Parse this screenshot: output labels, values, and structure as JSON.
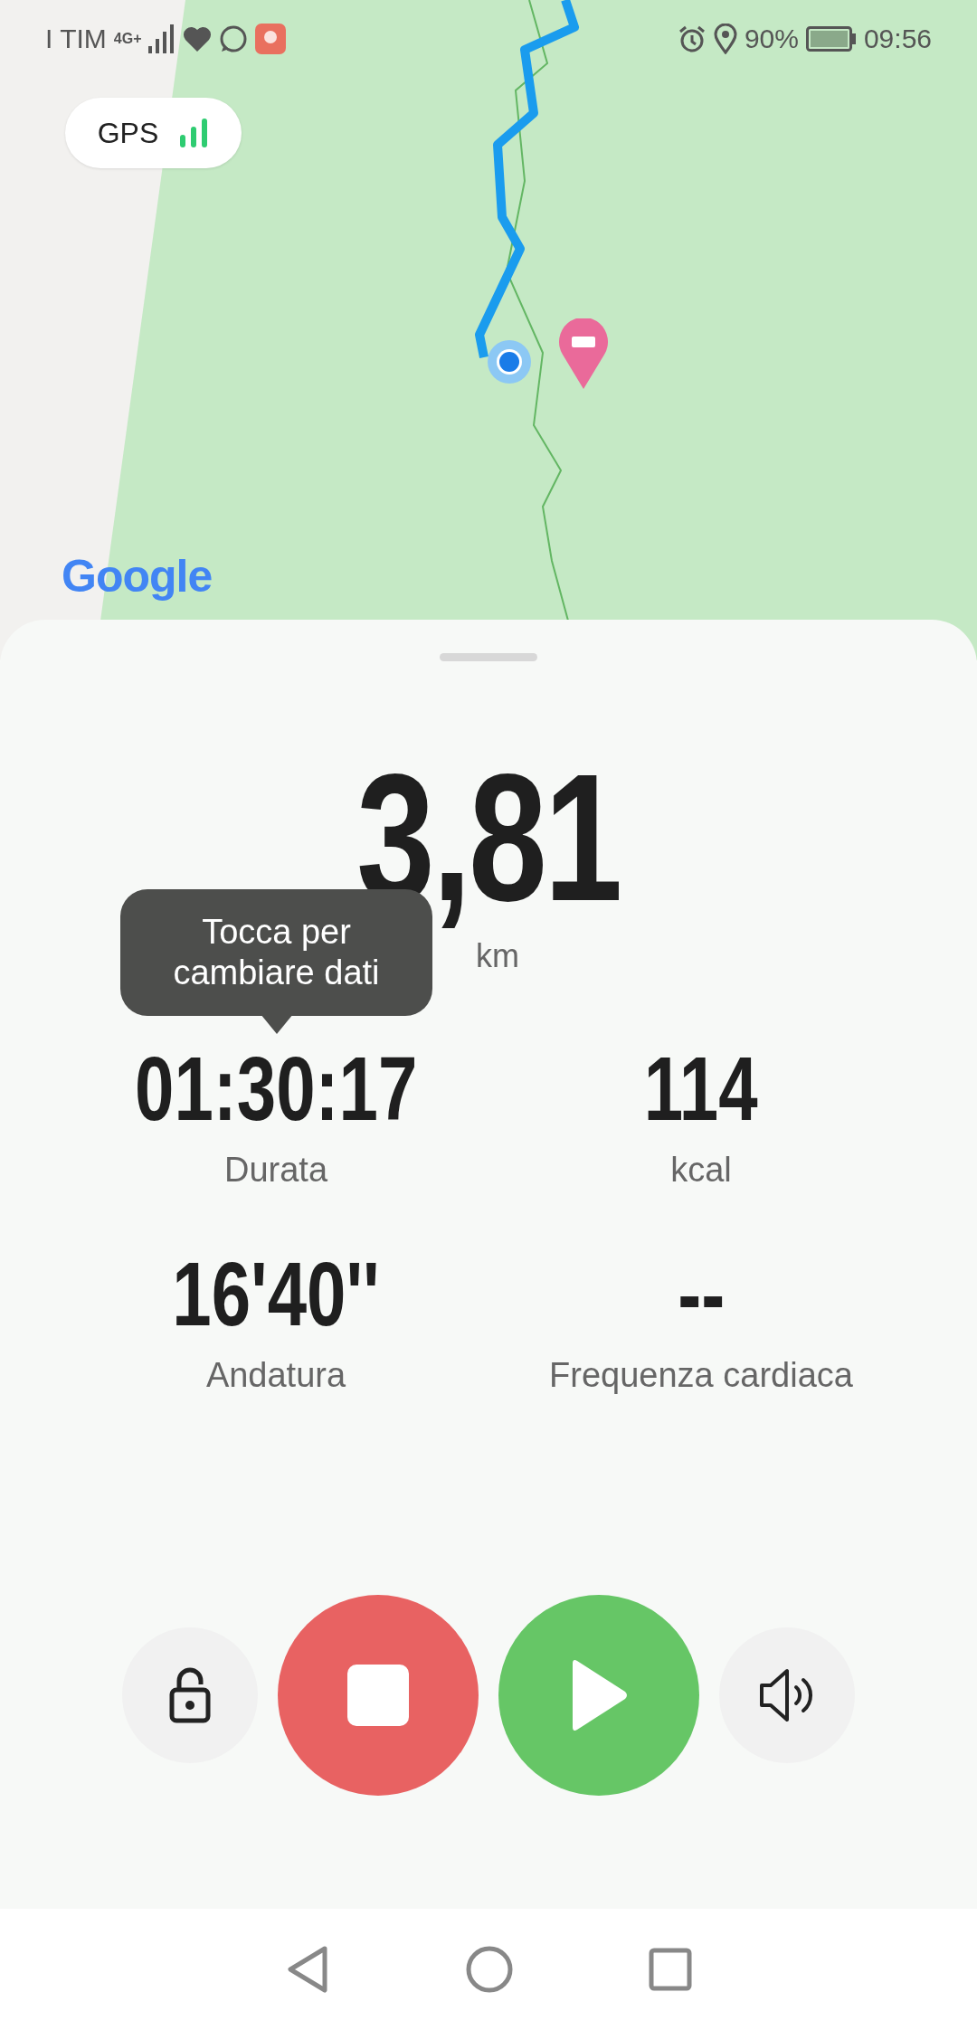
{
  "status_bar": {
    "carrier": "I TIM",
    "network": "4G+",
    "battery": "90%",
    "time": "09:56"
  },
  "map": {
    "kind": "picture",
    "gps": {
      "label": "GPS"
    },
    "attribution": "Google"
  },
  "panel": {
    "distance": {
      "value": "3,81",
      "unit": "km"
    },
    "tooltip": "Tocca per cambiare dati",
    "stats": [
      {
        "value": "01:30:17",
        "label": "Durata"
      },
      {
        "value": "114",
        "label": "kcal"
      },
      {
        "value": "16'40''",
        "label": "Andatura"
      },
      {
        "value": "--",
        "label": "Frequenza cardiaca"
      }
    ],
    "controls": [
      {
        "kind": "lock"
      },
      {
        "kind": "stop"
      },
      {
        "kind": "play"
      },
      {
        "kind": "sound"
      }
    ]
  }
}
